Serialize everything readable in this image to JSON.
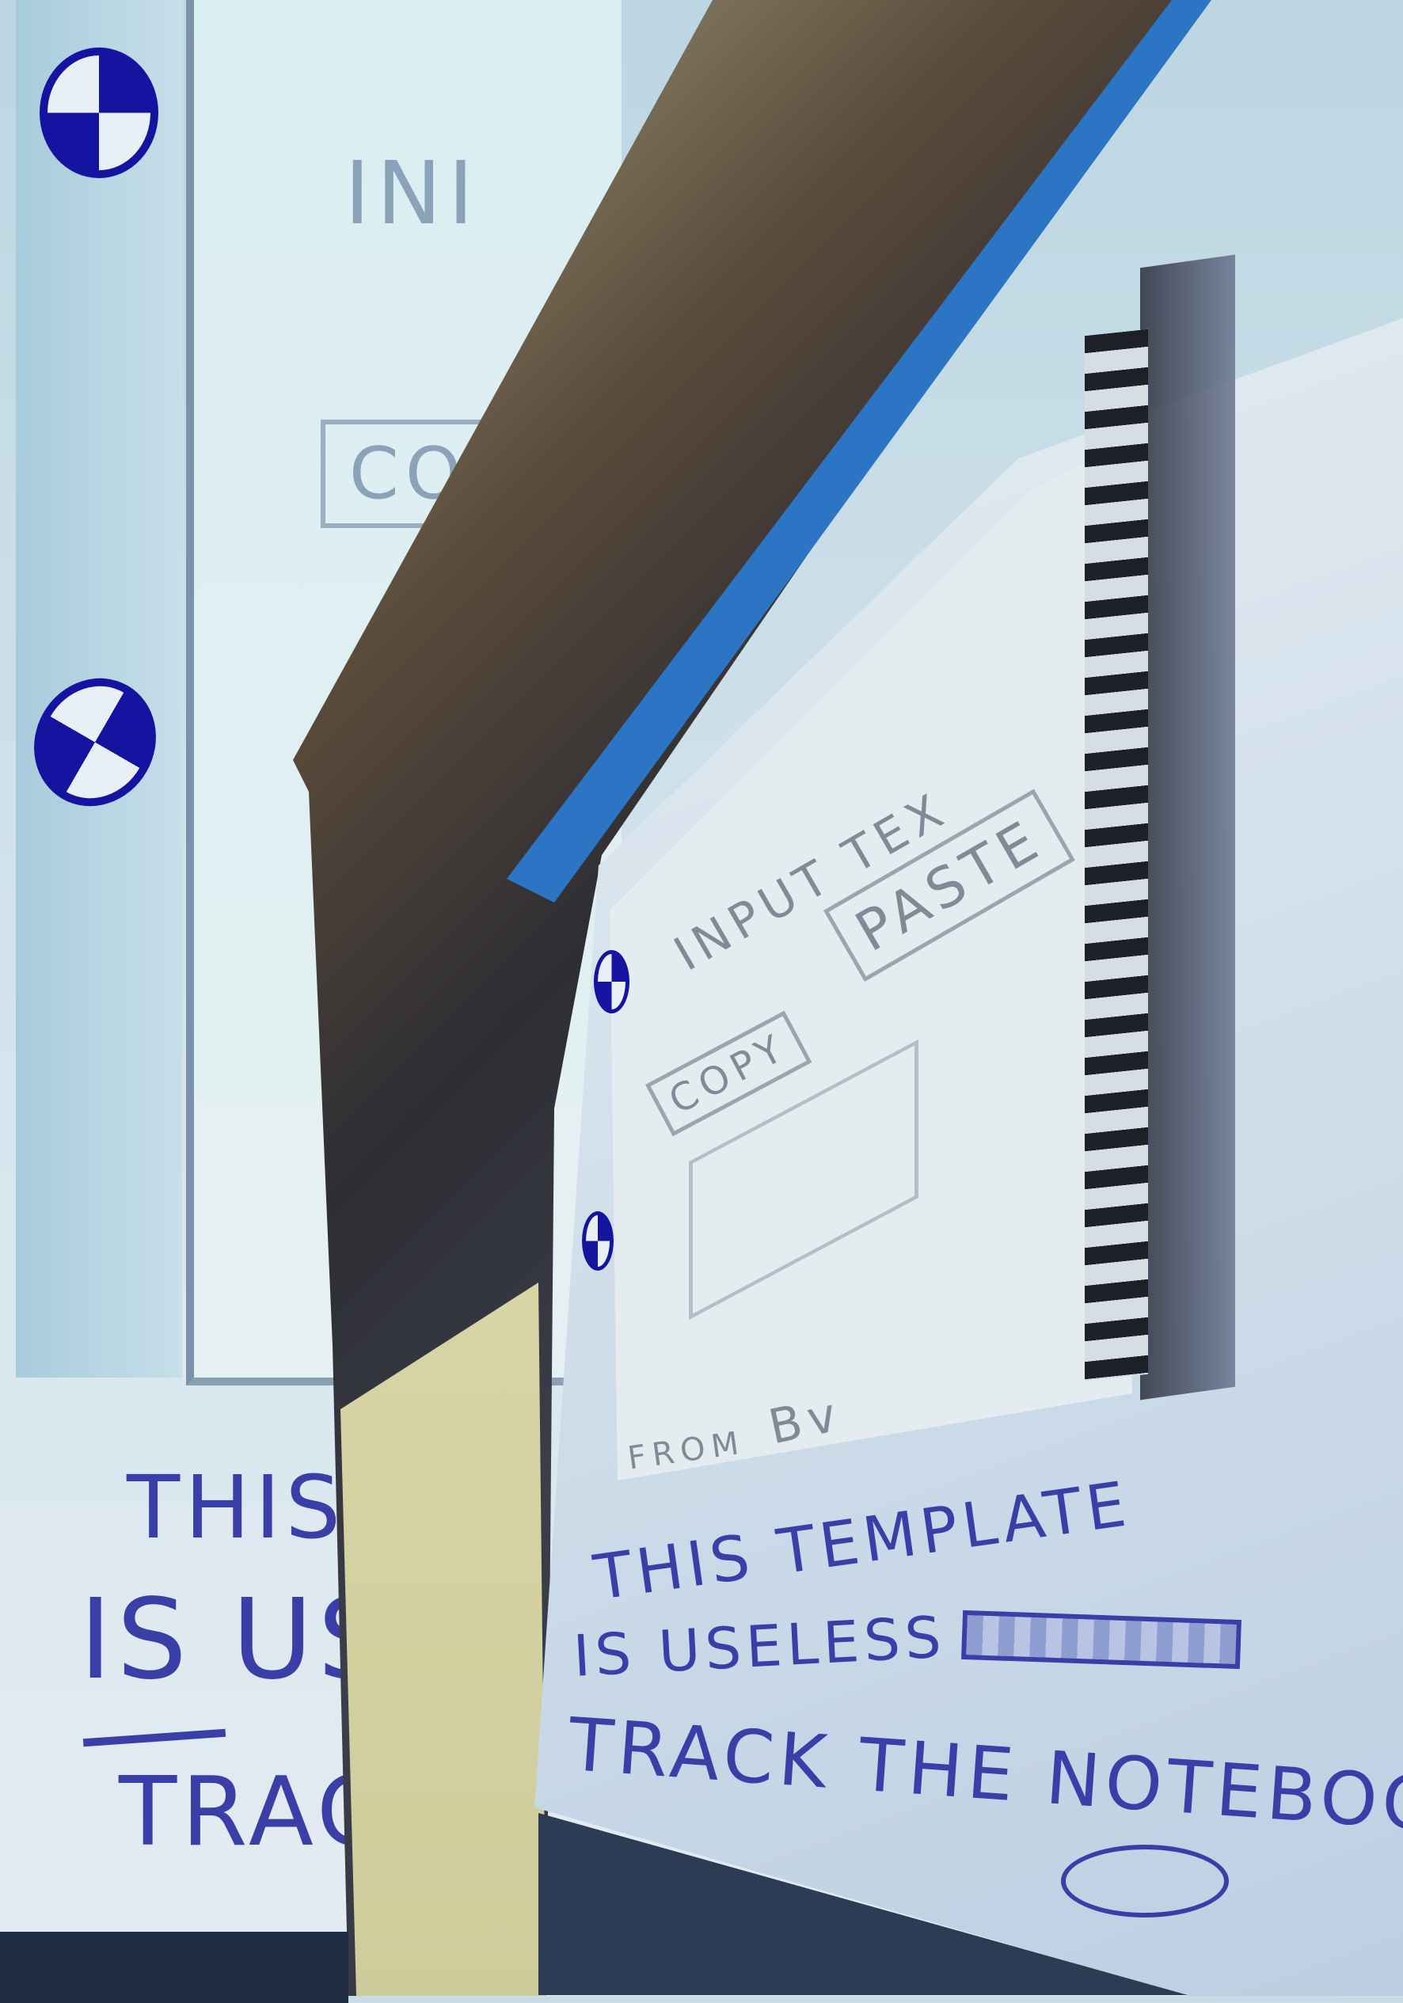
{
  "left_sketch": {
    "labels": [
      "INI",
      "CO"
    ],
    "handwriting": [
      "THIS",
      "IS US",
      "TRAC"
    ]
  },
  "notebook_sketch": {
    "labels": [
      "INPUT TEX",
      "PASTE",
      "COPY",
      "FROM",
      "Bv"
    ]
  },
  "handwriting": {
    "line1": "THIS TEMPLATE",
    "line2": "IS USELESS",
    "line3": "TRACK THE NOTEBOOK"
  },
  "icons": [
    "bmw-logo-circle",
    "bmw-logo-circle"
  ],
  "colors": {
    "ink": "#3a3fa8",
    "accent_blue": "#1414a0",
    "band": "#2c74c4"
  }
}
